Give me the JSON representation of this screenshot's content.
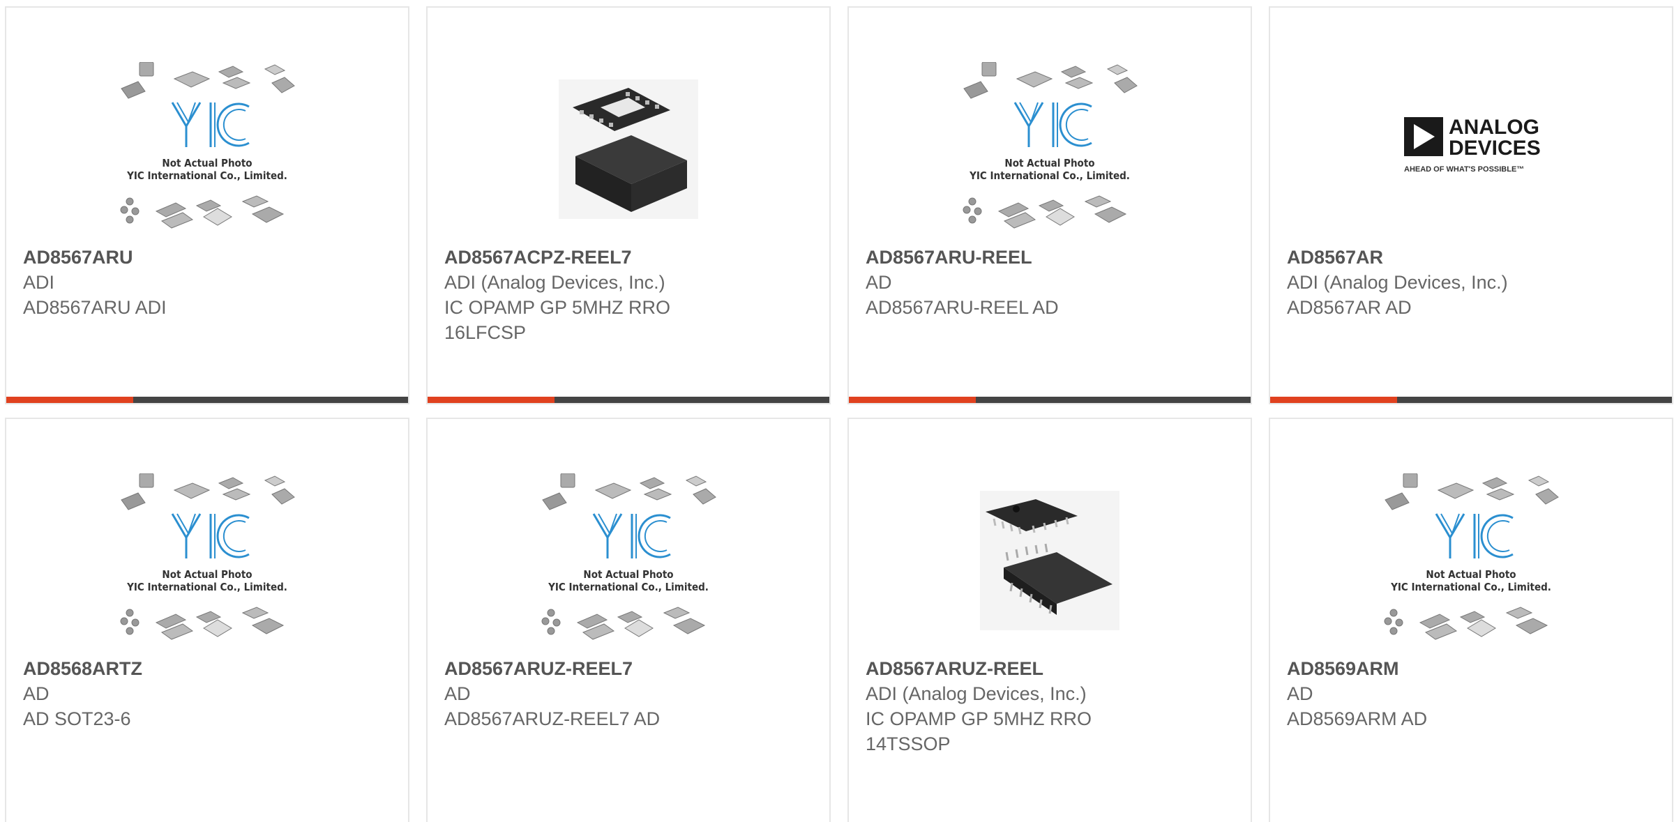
{
  "cards": [
    {
      "part": "AD8567ARU",
      "manufacturer": "ADI",
      "description": "AD8567ARU ADI",
      "image": "placeholder"
    },
    {
      "part": "AD8567ACPZ-REEL7",
      "manufacturer": "ADI (Analog Devices, Inc.)",
      "description": "IC OPAMP GP 5MHZ RRO 16LFCSP",
      "image": "lfcsp-chip"
    },
    {
      "part": "AD8567ARU-REEL",
      "manufacturer": "AD",
      "description": "AD8567ARU-REEL AD",
      "image": "placeholder"
    },
    {
      "part": "AD8567AR",
      "manufacturer": "ADI (Analog Devices, Inc.)",
      "description": "AD8567AR AD",
      "image": "adi-logo"
    },
    {
      "part": "AD8568ARTZ",
      "manufacturer": "AD",
      "description": "AD SOT23-6",
      "image": "placeholder"
    },
    {
      "part": "AD8567ARUZ-REEL7",
      "manufacturer": "AD",
      "description": "AD8567ARUZ-REEL7 AD",
      "image": "placeholder"
    },
    {
      "part": "AD8567ARUZ-REEL",
      "manufacturer": "ADI (Analog Devices, Inc.)",
      "description": "IC OPAMP GP 5MHZ RRO 14TSSOP",
      "image": "tssop-chip"
    },
    {
      "part": "AD8569ARM",
      "manufacturer": "AD",
      "description": "AD8569ARM AD",
      "image": "placeholder"
    }
  ],
  "placeholder": {
    "logo_text": "YIC",
    "caption_line1": "Not Actual Photo",
    "caption_line2": "YIC International Co., Limited."
  },
  "adi_logo": {
    "line1": "ANALOG",
    "line2": "DEVICES",
    "tagline": "AHEAD OF WHAT'S POSSIBLE™"
  },
  "colors": {
    "accent": "#e0411f",
    "bar": "#444444",
    "yic_blue": "#2b8fd0",
    "border": "#e6e6e6"
  }
}
